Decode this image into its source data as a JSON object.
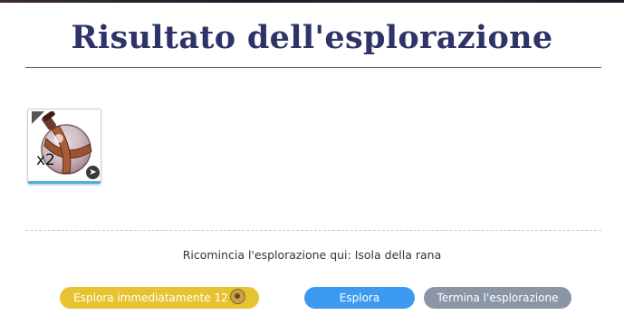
{
  "dialog": {
    "title": "Risultato dell'esplorazione"
  },
  "rewards": [
    {
      "icon": "potion-flask-icon",
      "quantity": "x2"
    }
  ],
  "restart": {
    "text": "Ricomincia l'esplorazione qui: Isola della rana"
  },
  "buttons": {
    "explore_now_label": "Esplora immediatamente 12",
    "explore_now_icon": "coin-icon",
    "explore_label": "Esplora",
    "end_label": "Termina l'esplorazione"
  },
  "colors": {
    "title": "#2f3468",
    "explore_now": "#e8c331",
    "explore": "#3c9bf0",
    "end": "#8a96a6"
  }
}
